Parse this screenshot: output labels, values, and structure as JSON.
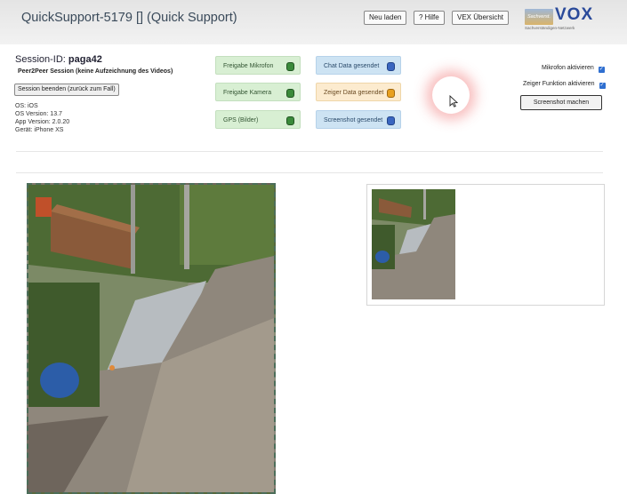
{
  "header": {
    "title": "QuickSupport-5179 [] (Quick Support)",
    "buttons": {
      "reload": "Neu laden",
      "help": "? Hilfe",
      "overview": "VEX Übersicht"
    },
    "logo": {
      "brand": "VOX",
      "badge": "Sachverst.",
      "subtext": "Sachverständigen-Netzwerk"
    }
  },
  "session": {
    "id_label": "Session-ID:",
    "id_value": "paga42",
    "mode": "Peer2Peer Session (keine Aufzeichnung des Videos)",
    "end_button": "Session beenden (zurück zum Fall)",
    "device": {
      "os": "OS: iOS",
      "os_version": "OS Version: 13.7",
      "app_version": "App Version: 2.0.20",
      "device": "Gerät: iPhone XS"
    }
  },
  "tiles": {
    "mic": {
      "label": "Freigabe Mikrofon",
      "status_color": "#3a8a3a"
    },
    "camera": {
      "label": "Freigabe Kamera",
      "status_color": "#3a8a3a"
    },
    "gps": {
      "label": "GPS (Bilder)",
      "status_color": "#3a8a3a"
    },
    "chat": {
      "label": "Chat Data gesendet",
      "status_color": "#3a66c0"
    },
    "pointer": {
      "label": "Zeiger Data gesendet",
      "status_color": "#e8a020"
    },
    "screenshot": {
      "label": "Screenshot gesendet",
      "status_color": "#3a66c0"
    }
  },
  "controls": {
    "mic_toggle": {
      "label": "Mikrofon aktivieren",
      "checked": true
    },
    "pointer_toggle": {
      "label": "Zeiger Funktion aktivieren",
      "checked": true
    },
    "screenshot_button": "Screenshot machen"
  }
}
